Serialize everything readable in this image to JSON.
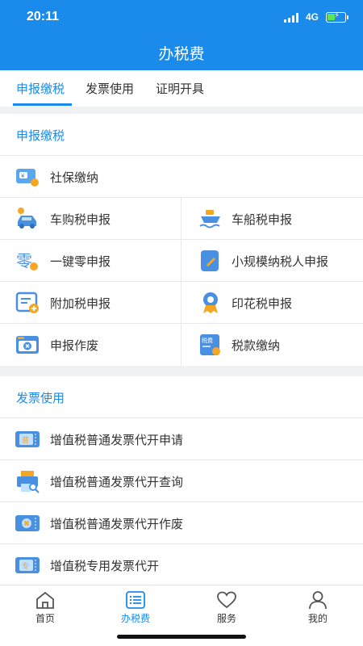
{
  "status_bar": {
    "time": "20:11",
    "network": "4G"
  },
  "header": {
    "title": "办税费"
  },
  "tabs": [
    {
      "label": "申报缴税",
      "active": true
    },
    {
      "label": "发票使用",
      "active": false
    },
    {
      "label": "证明开具",
      "active": false
    }
  ],
  "declare_section": {
    "title": "申报缴税",
    "items": [
      {
        "label": "社保缴纳",
        "icon": "social-security-card-icon"
      },
      {
        "label": "车购税申报",
        "icon": "car-icon"
      },
      {
        "label": "车船税申报",
        "icon": "ship-icon"
      },
      {
        "label": "一键零申报",
        "icon": "zero-declare-icon"
      },
      {
        "label": "小规模纳税人申报",
        "icon": "small-taxpayer-icon"
      },
      {
        "label": "附加税申报",
        "icon": "add-form-icon"
      },
      {
        "label": "印花税申报",
        "icon": "stamp-medal-icon"
      },
      {
        "label": "申报作废",
        "icon": "void-declare-icon"
      },
      {
        "label": "税款缴纳",
        "icon": "tax-payment-icon"
      }
    ]
  },
  "invoice_section": {
    "title": "发票使用",
    "items": [
      {
        "label": "增值税普通发票代开申请",
        "icon": "invoice-apply-icon"
      },
      {
        "label": "增值税普通发票代开查询",
        "icon": "invoice-query-icon"
      },
      {
        "label": "增值税普通发票代开作废",
        "icon": "invoice-void-icon"
      },
      {
        "label": "增值税专用发票代开",
        "icon": "special-invoice-icon"
      }
    ]
  },
  "bottom_nav": [
    {
      "label": "首页",
      "icon": "home-icon",
      "active": false
    },
    {
      "label": "办税费",
      "icon": "list-icon",
      "active": true
    },
    {
      "label": "服务",
      "icon": "heart-icon",
      "active": false
    },
    {
      "label": "我的",
      "icon": "user-icon",
      "active": false
    }
  ],
  "colors": {
    "primary": "#1a8bea",
    "orange": "#f5a623",
    "background": "#f0f1f3"
  }
}
